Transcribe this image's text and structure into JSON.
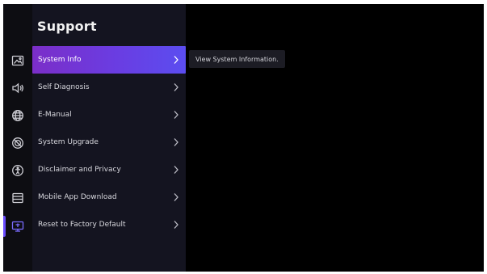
{
  "panel": {
    "title": "Support"
  },
  "menu": {
    "items": [
      {
        "label": "System Info",
        "selected": true
      },
      {
        "label": "Self Diagnosis",
        "selected": false
      },
      {
        "label": "E-Manual",
        "selected": false
      },
      {
        "label": "System Upgrade",
        "selected": false
      },
      {
        "label": "Disclaimer and Privacy",
        "selected": false
      },
      {
        "label": "Mobile App Download",
        "selected": false
      },
      {
        "label": "Reset to Factory Default",
        "selected": false
      }
    ]
  },
  "tooltip": {
    "text": "View System Information."
  },
  "rail": {
    "icons": [
      "picture-icon",
      "sound-icon",
      "network-icon",
      "general-icon",
      "accessibility-icon",
      "apps-icon",
      "support-icon"
    ],
    "active": "support-icon"
  },
  "colors": {
    "background": "#000000",
    "panel": "#141420",
    "rail": "#0d0d12",
    "accent_start": "#7b2ec8",
    "accent_end": "#5b4df0",
    "indicator": "#6a4cff",
    "text": "#d8d8de"
  }
}
